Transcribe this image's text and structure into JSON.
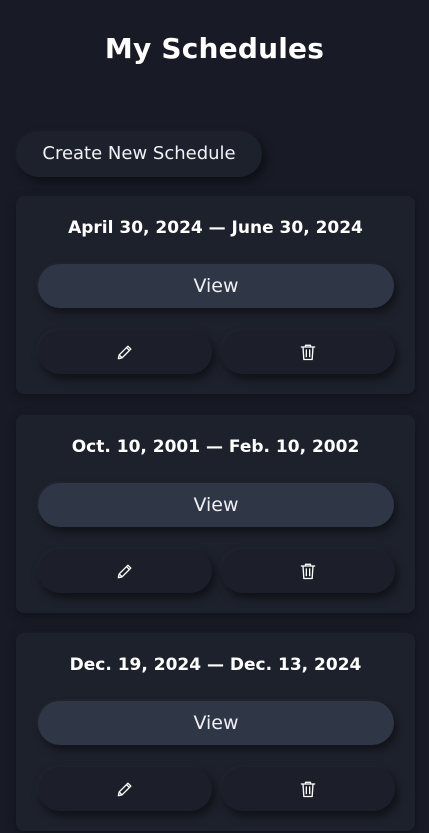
{
  "header": {
    "title": "My Schedules"
  },
  "toolbar": {
    "create_label": "Create New Schedule"
  },
  "schedules": [
    {
      "title": "April 30, 2024 — June 30, 2024",
      "view_label": "View",
      "edit_icon": "pencil-icon",
      "delete_icon": "trash-icon"
    },
    {
      "title": "Oct. 10, 2001 — Feb. 10, 2002",
      "view_label": "View",
      "edit_icon": "pencil-icon",
      "delete_icon": "trash-icon"
    },
    {
      "title": "Dec. 19, 2024 — Dec. 13, 2024",
      "view_label": "View",
      "edit_icon": "pencil-icon",
      "delete_icon": "trash-icon"
    }
  ],
  "theme": {
    "background": "#181b25",
    "card": "#1d212b",
    "view_button": "#2f3645",
    "text": "#ffffff"
  }
}
